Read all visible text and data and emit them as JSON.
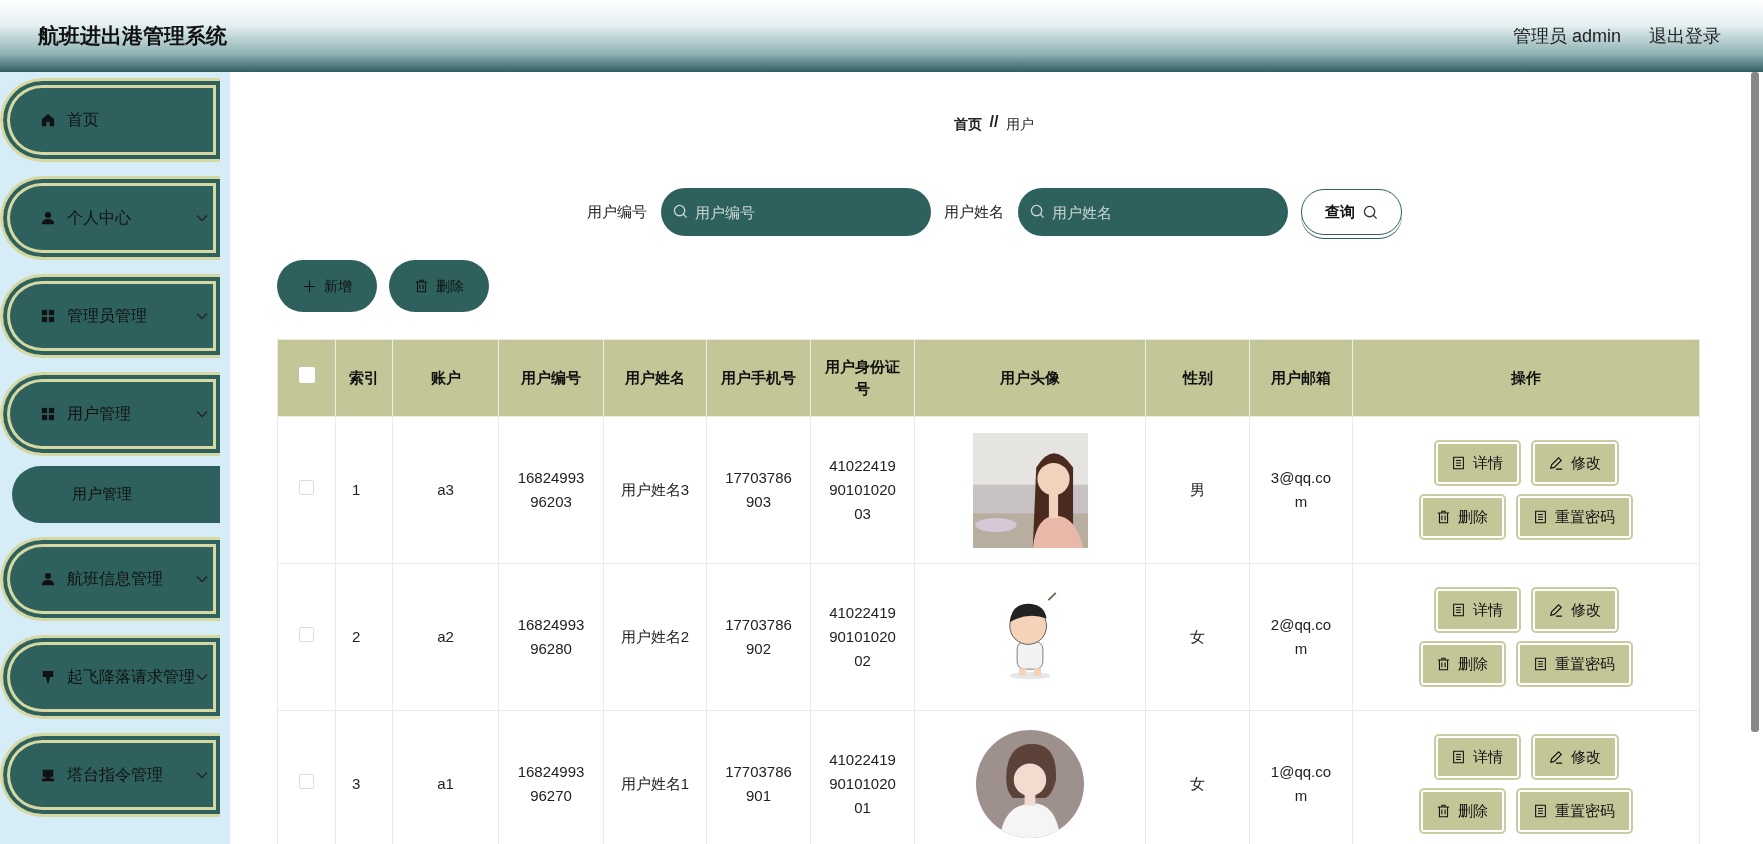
{
  "header": {
    "title": "航班进出港管理系统",
    "user": "管理员 admin",
    "logout": "退出登录"
  },
  "sidebar": {
    "items": [
      {
        "label": "首页",
        "kind": "link"
      },
      {
        "label": "个人中心",
        "kind": "group"
      },
      {
        "label": "管理员管理",
        "kind": "group"
      },
      {
        "label": "用户管理",
        "kind": "group",
        "children": [
          {
            "label": "用户管理"
          }
        ]
      },
      {
        "label": "航班信息管理",
        "kind": "group"
      },
      {
        "label": "起飞降落请求管理",
        "kind": "group"
      },
      {
        "label": "塔台指令管理",
        "kind": "group"
      }
    ]
  },
  "breadcrumb": {
    "items": [
      "首页",
      "用户"
    ],
    "separator": "//"
  },
  "search": {
    "fields": [
      {
        "label": "用户编号",
        "placeholder": "用户编号"
      },
      {
        "label": "用户姓名",
        "placeholder": "用户姓名"
      }
    ],
    "button": "查询"
  },
  "actions": [
    {
      "label": "新增",
      "kind": "add"
    },
    {
      "label": "删除",
      "kind": "delete"
    }
  ],
  "table": {
    "header_checked": false,
    "columns": [
      "索引",
      "账户",
      "用户编号",
      "用户姓名",
      "用户手机号",
      "用户身份证号",
      "用户头像",
      "性别",
      "用户邮箱",
      "操作"
    ],
    "rows": [
      {
        "checked": false,
        "index": "1",
        "account": "a3",
        "user_no": "1682499396203",
        "name": "用户姓名3",
        "phone": "17703786903",
        "id_no": "410224199010102003",
        "gender": "男",
        "email": "3@qq.com",
        "buttons": [
          {
            "label": "详情",
            "kind": "detail"
          },
          {
            "label": "修改",
            "kind": "edit"
          },
          {
            "label": "删除",
            "kind": "delete"
          },
          {
            "label": "重置密码",
            "kind": "detail"
          }
        ]
      },
      {
        "checked": false,
        "index": "2",
        "account": "a2",
        "user_no": "1682499396280",
        "name": "用户姓名2",
        "phone": "17703786902",
        "id_no": "410224199010102002",
        "gender": "女",
        "email": "2@qq.com",
        "buttons": [
          {
            "label": "详情",
            "kind": "detail"
          },
          {
            "label": "修改",
            "kind": "edit"
          },
          {
            "label": "删除",
            "kind": "delete"
          },
          {
            "label": "重置密码",
            "kind": "detail"
          }
        ]
      },
      {
        "checked": false,
        "index": "3",
        "account": "a1",
        "user_no": "1682499396270",
        "name": "用户姓名1",
        "phone": "17703786901",
        "id_no": "410224199010102001",
        "gender": "女",
        "email": "1@qq.com",
        "buttons": [
          {
            "label": "详情",
            "kind": "detail"
          },
          {
            "label": "修改",
            "kind": "edit"
          },
          {
            "label": "删除",
            "kind": "delete"
          },
          {
            "label": "重置密码",
            "kind": "detail"
          }
        ]
      }
    ]
  }
}
